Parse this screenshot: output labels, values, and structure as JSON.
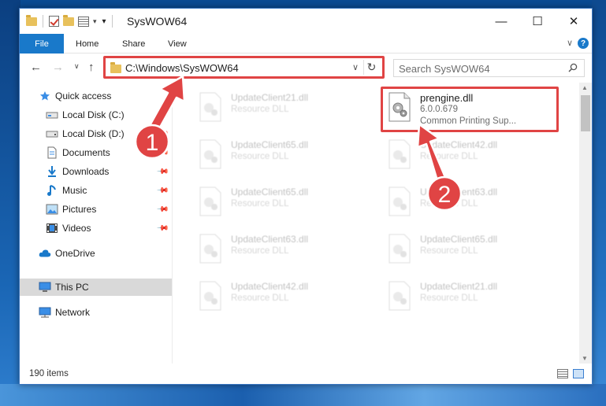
{
  "window": {
    "title": "SysWOW64",
    "controls": {
      "minimize": "—",
      "maximize": "☐",
      "close": "✕"
    }
  },
  "ribbon": {
    "tabs": [
      "File",
      "Home",
      "Share",
      "View"
    ],
    "help": "?"
  },
  "address_bar": {
    "path": "C:\\Windows\\SysWOW64"
  },
  "search": {
    "placeholder": "Search SysWOW64"
  },
  "nav_pane": {
    "items": [
      {
        "label": "Quick access",
        "icon": "star-icon",
        "pinned": false
      },
      {
        "label": "Local Disk (C:)",
        "icon": "drive-icon",
        "pinned": true
      },
      {
        "label": "Local Disk (D:)",
        "icon": "drive-icon",
        "pinned": true
      },
      {
        "label": "Documents",
        "icon": "documents-icon",
        "pinned": true
      },
      {
        "label": "Downloads",
        "icon": "download-icon",
        "pinned": true
      },
      {
        "label": "Music",
        "icon": "music-icon",
        "pinned": true
      },
      {
        "label": "Pictures",
        "icon": "pictures-icon",
        "pinned": true
      },
      {
        "label": "Videos",
        "icon": "videos-icon",
        "pinned": true
      },
      {
        "label": "OneDrive",
        "icon": "cloud-icon",
        "pinned": false
      },
      {
        "label": "This PC",
        "icon": "computer-icon",
        "pinned": false,
        "selected": true
      },
      {
        "label": "Network",
        "icon": "network-icon",
        "pinned": false
      }
    ]
  },
  "files": {
    "highlighted": {
      "name": "prengine.dll",
      "version": "6.0.0.679",
      "description": "Common Printing Sup..."
    },
    "background": [
      {
        "name": "UpdateClient21.dll",
        "type": "Resource DLL"
      },
      {
        "name": "UpdateClient65.dll",
        "type": "Resource DLL"
      },
      {
        "name": "UpdateClient42.dll",
        "type": "Resource DLL"
      },
      {
        "name": "UpdateClient65.dll",
        "type": "Resource DLL"
      },
      {
        "name": "UpdateClient63.dll",
        "type": "Resource DLL"
      },
      {
        "name": "UpdateClient63.dll",
        "type": "Resource DLL"
      },
      {
        "name": "UpdateClient65.dll",
        "type": "Resource DLL"
      },
      {
        "name": "UpdateClient42.dll",
        "type": "Resource DLL"
      },
      {
        "name": "UpdateClient21.dll",
        "type": "Resource DLL"
      }
    ]
  },
  "status": {
    "item_count": "190 items"
  },
  "annotations": {
    "step1": "1",
    "step2": "2",
    "highlight_color": "#e04444"
  }
}
